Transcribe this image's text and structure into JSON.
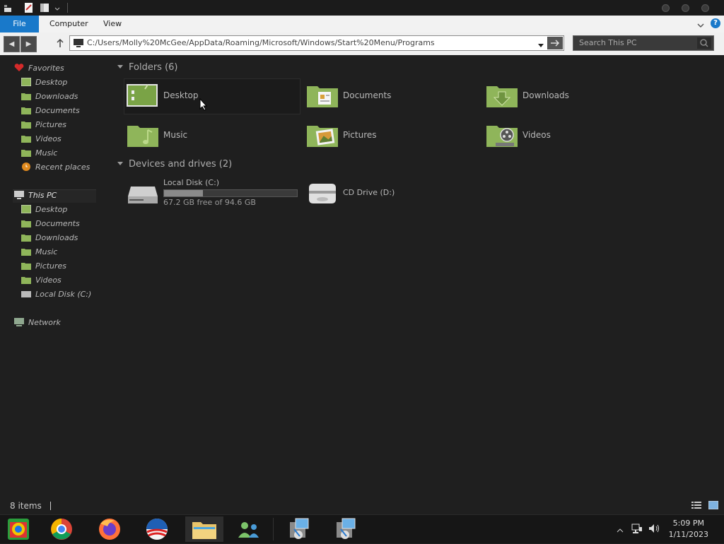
{
  "window": {
    "quick_access_icons": [
      "app-menu-icon",
      "properties-icon",
      "new-folder-icon",
      "customize-arrow-icon"
    ],
    "controls": [
      "minimize-button",
      "maximize-button",
      "close-button"
    ]
  },
  "ribbon": {
    "tabs": [
      "File",
      "Computer",
      "View"
    ],
    "accent": "#1979ca"
  },
  "navbar": {
    "address": "C:/Users/Molly%20McGee/AppData/Roaming/Microsoft/Windows/Start%20Menu/Programs",
    "search_placeholder": "Search This PC"
  },
  "sidebar": {
    "favorites_label": "Favorites",
    "favorites": [
      "Desktop",
      "Downloads",
      "Documents",
      "Pictures",
      "Videos",
      "Music",
      "Recent places"
    ],
    "thispc_label": "This PC",
    "thispc": [
      "Desktop",
      "Documents",
      "Downloads",
      "Music",
      "Pictures",
      "Videos",
      "Local Disk (C:)"
    ],
    "network_label": "Network"
  },
  "main": {
    "folders_header": "Folders (6)",
    "folders": [
      "Desktop",
      "Documents",
      "Downloads",
      "Music",
      "Pictures",
      "Videos"
    ],
    "devices_header": "Devices and drives (2)",
    "drives": [
      {
        "name": "Local Disk (C:)",
        "free": "67.2 GB free of 94.6 GB",
        "used_fraction": 0.29
      },
      {
        "name": "CD Drive (D:)"
      }
    ],
    "folder_color": "#8fb55a"
  },
  "status": {
    "items": "8 items"
  },
  "taskbar": {
    "apps": [
      "start-button",
      "chrome-icon",
      "firefox-icon",
      "obama-logo-icon",
      "file-explorer-icon",
      "network-people-icon",
      "installer-icon",
      "installer-icon"
    ],
    "time": "5:09 PM",
    "date": "1/11/2023"
  }
}
